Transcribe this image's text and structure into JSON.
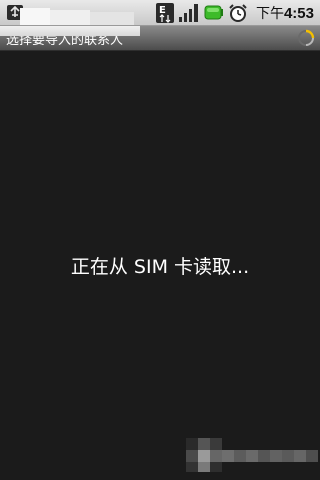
{
  "status_bar": {
    "network_type": "E",
    "time_prefix": "下午",
    "time": "4:53",
    "icons": [
      "usb-debug-icon",
      "network-edge-icon",
      "signal-strength-icon",
      "battery-charging-icon",
      "alarm-clock-icon"
    ],
    "battery_color": "#3dbb2a"
  },
  "title_bar": {
    "title": "选择要导入的联系人",
    "spinner_icon": "loading-spinner-icon",
    "spinner_color": "#f5c000"
  },
  "content": {
    "loading_message": "正在从 SIM 卡读取..."
  }
}
